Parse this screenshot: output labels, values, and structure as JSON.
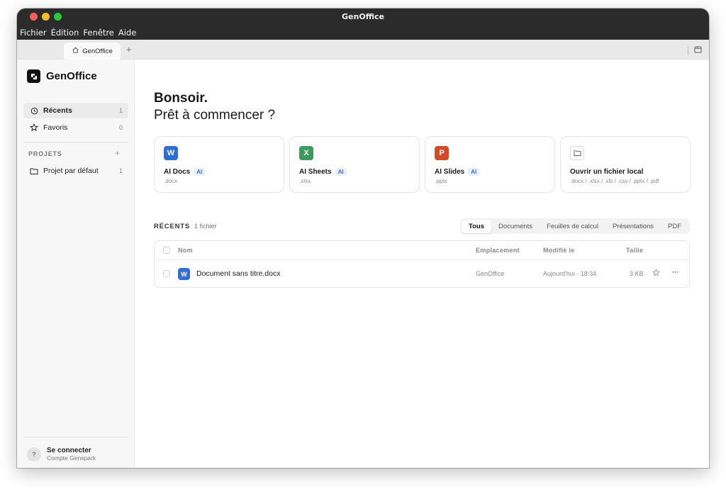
{
  "window": {
    "title": "GenOffice"
  },
  "menubar": [
    "Fichier",
    "Édition",
    "Fenêtre",
    "Aide"
  ],
  "tabs": {
    "active_label": "GenOffice",
    "add_label": "+"
  },
  "sidebar": {
    "brand": "GenOffice",
    "nav": [
      {
        "label": "Récents",
        "count": "1"
      },
      {
        "label": "Favoris",
        "count": "0"
      }
    ],
    "projects_label": "PROJETS",
    "projects_add": "+",
    "projects": [
      {
        "label": "Projet par défaut",
        "count": "1"
      }
    ],
    "account": {
      "avatar": "?",
      "name": "Se connecter",
      "subtitle": "Compte Genspark"
    }
  },
  "main": {
    "greeting": "Bonsoir.",
    "subgreeting": "Prêt à commencer ?",
    "cards": [
      {
        "icon_letter": "W",
        "title": "AI Docs",
        "badge": "AI",
        "subtitle": ".docx",
        "color": "#2f6fd3"
      },
      {
        "icon_letter": "X",
        "title": "AI Sheets",
        "badge": "AI",
        "subtitle": ".xlsx",
        "color": "#3b9a5c"
      },
      {
        "icon_letter": "P",
        "title": "AI Slides",
        "badge": "AI",
        "subtitle": ".pptx",
        "color": "#d04a2b"
      },
      {
        "icon": "folder-icon",
        "title": "Ouvrir un fichier local",
        "subtitle": ".docx / .xlsx / .xls / .csv / .pptx / .pdf"
      }
    ],
    "recents": {
      "title": "RÉCENTS",
      "count": "1 fichier",
      "filters": [
        "Tous",
        "Documents",
        "Feuilles de calcul",
        "Présentations",
        "PDF"
      ],
      "active_filter": "Tous",
      "columns": {
        "name": "Nom",
        "location": "Emplacement",
        "modified": "Modifié le",
        "size": "Taille"
      },
      "rows": [
        {
          "icon_letter": "W",
          "name": "Document sans titre.docx",
          "location": "GenOffice",
          "modified": "Aujourd'hui · 18:34",
          "size": "3 KB",
          "more": "···"
        }
      ]
    }
  }
}
